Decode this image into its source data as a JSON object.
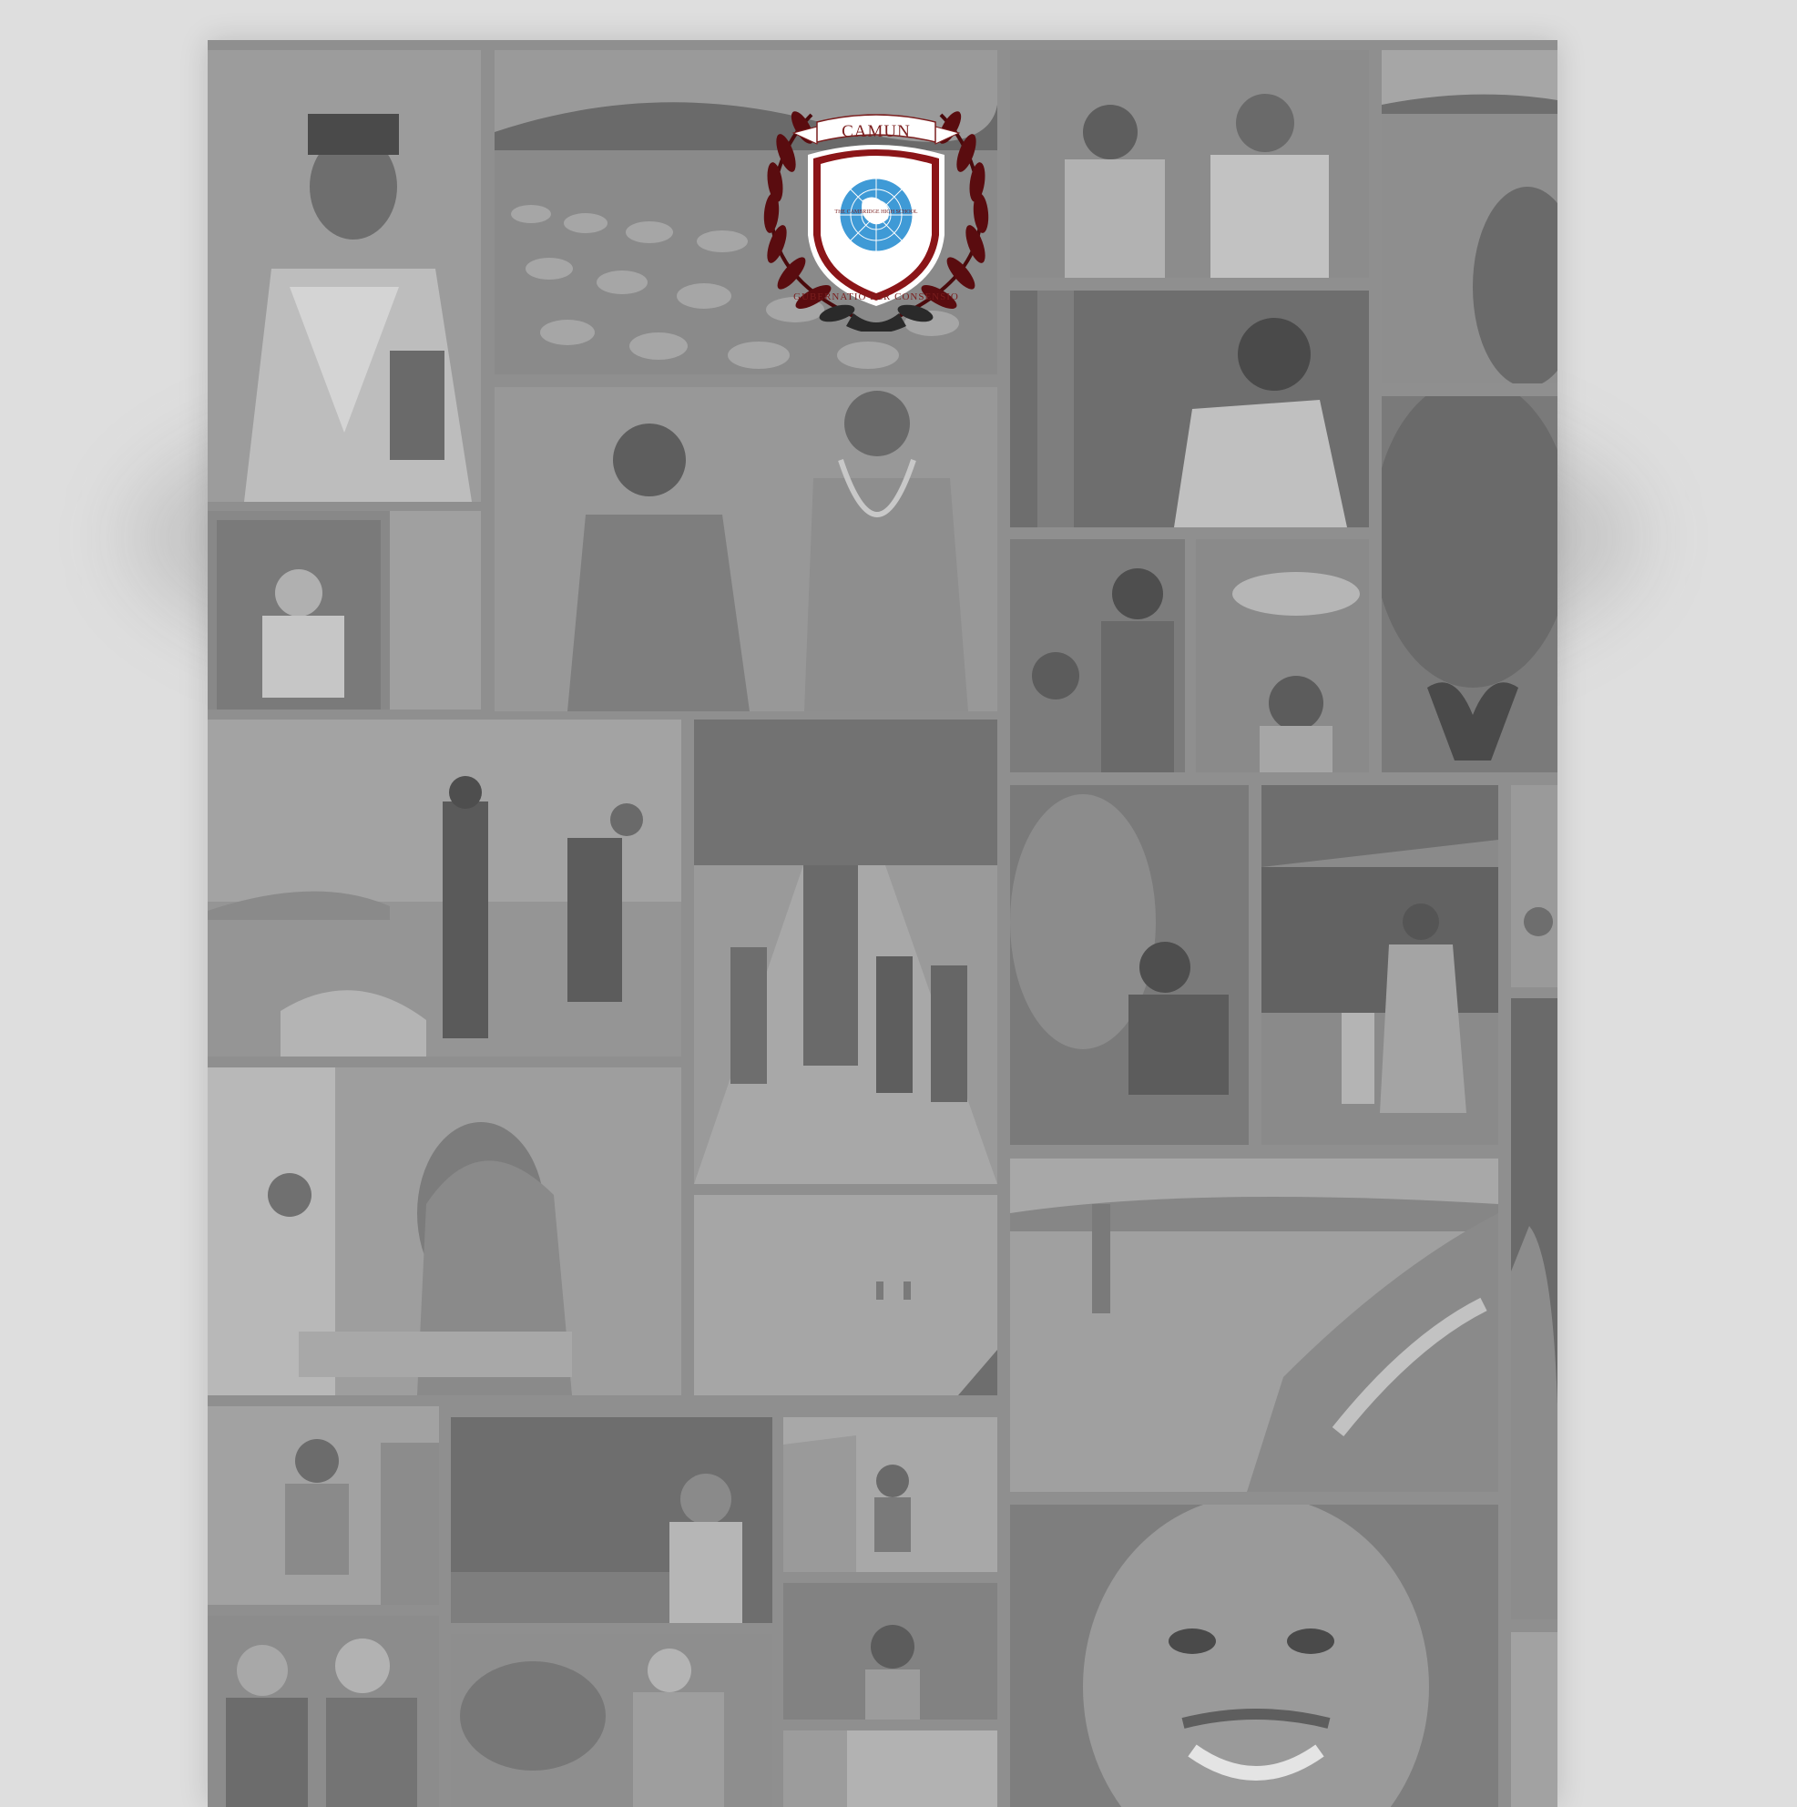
{
  "logo": {
    "title": "CAMUN",
    "motto": "GUBERNATIO PER CONSENSIO",
    "ring_text": "THE CAMBRIDGE HIGH SCHOOL",
    "small_text": "ABU DHABI",
    "colors": {
      "maroon": "#6e0f12",
      "laurel": "#4a0a0c",
      "blue": "#3f9ad6",
      "background": "#dedede"
    }
  },
  "collage": {
    "style": "grayscale photo mosaic background",
    "photo_count": 33
  }
}
